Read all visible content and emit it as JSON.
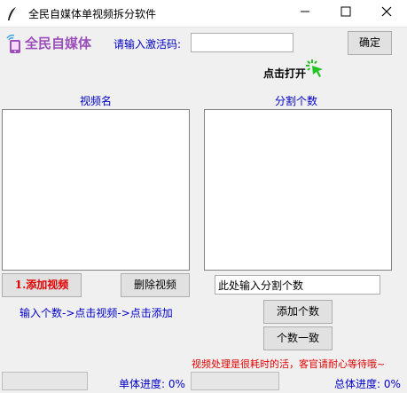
{
  "window": {
    "title": "全民自媒体单视频拆分软件",
    "minimize_icon": "minimize-icon",
    "maximize_icon": "maximize-icon",
    "close_icon": "close-icon"
  },
  "logo": {
    "text": "全民自媒体",
    "icon": "phone-wifi-icon"
  },
  "activation": {
    "label": "请输入激活码:",
    "value": "",
    "confirm_label": "确定"
  },
  "click_open": {
    "label": "点击打开",
    "icon": "cursor-click-icon"
  },
  "video_list": {
    "header": "视频名",
    "items": []
  },
  "split_list": {
    "header": "分割个数",
    "items": []
  },
  "add_video_label": "1.添加视频",
  "delete_video_label": "删除视频",
  "split_input": {
    "value": "此处输入分割个数"
  },
  "hint": "输入个数->点击视频->点击添加",
  "add_count_label": "添加个数",
  "uniform_count_label": "个数一致",
  "status_message": "视频处理是很耗时的活，客官请耐心等待哦~",
  "single_progress": {
    "label": "单体进度:",
    "value": "0%",
    "fraction": 0
  },
  "total_progress": {
    "label": "总体进度:",
    "value": "0%",
    "fraction": 0
  },
  "colors": {
    "logo": "#9b4fb8",
    "label_blue": "#0000c8",
    "status_red": "#e00000",
    "cursor_green": "#22c322"
  }
}
